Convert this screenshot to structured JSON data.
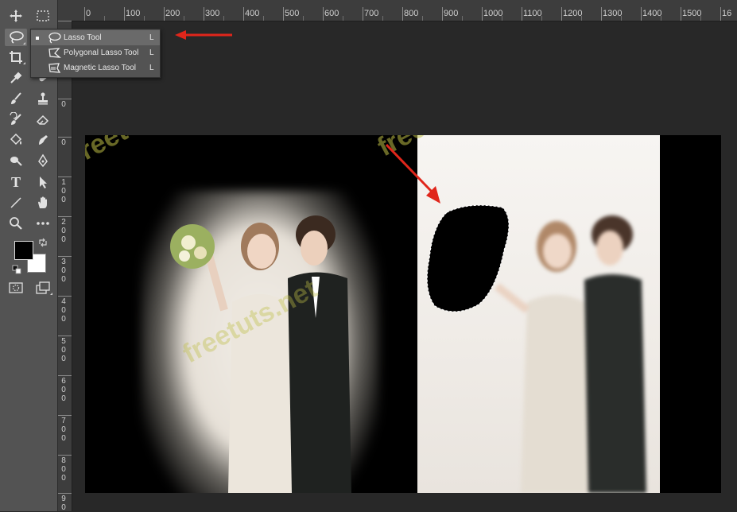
{
  "toolbar": {
    "tools_left": [
      "move-tool",
      "lasso-tool",
      "crop-tool",
      "eyedropper-tool",
      "brush-tool",
      "history-brush-tool",
      "fill-tool",
      "dodge-tool",
      "type-tool",
      "line-tool",
      "zoom-tool"
    ],
    "type_tool_glyph": "T"
  },
  "colors": {
    "foreground": "#000000",
    "background": "#ffffff",
    "accent_arrow": "#e0261b",
    "watermark": "#bebe46"
  },
  "flyout": {
    "items": [
      {
        "label": "Lasso Tool",
        "shortcut": "L",
        "selected": true
      },
      {
        "label": "Polygonal Lasso Tool",
        "shortcut": "L",
        "selected": false
      },
      {
        "label": "Magnetic Lasso Tool",
        "shortcut": "L",
        "selected": false
      }
    ]
  },
  "ruler": {
    "h_labels": [
      "0",
      "100",
      "200",
      "300",
      "400",
      "500",
      "600",
      "700",
      "800",
      "900",
      "1000",
      "1100",
      "1200",
      "1300",
      "1400",
      "1500",
      "16"
    ],
    "v_labels": [
      "0",
      "1\n0\n0",
      "2\n0\n0",
      "3\n0\n0",
      "4\n0\n0",
      "5\n0\n0",
      "6\n0\n0",
      "7\n0\n0",
      "8\n0\n0",
      "9\n0",
      "0"
    ]
  },
  "watermarks": [
    "freetuts.net",
    "freetuts.net",
    "freetuts.net"
  ]
}
